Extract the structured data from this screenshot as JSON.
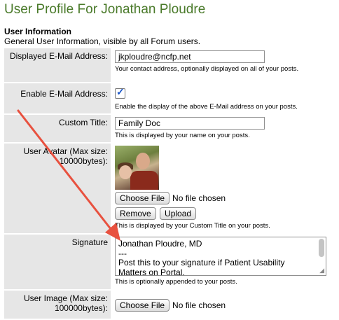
{
  "page": {
    "title": "User Profile For Jonathan Ploudre"
  },
  "section": {
    "heading": "User Information",
    "description": "General User Information, visible by all Forum users."
  },
  "fields": {
    "email": {
      "label": "Displayed E-Mail Address:",
      "value": "jkploudre@ncfp.net",
      "help": "Your contact address, optionally displayed on all of your posts."
    },
    "enable_email": {
      "label": "Enable E-Mail Address:",
      "checked": true,
      "help": "Enable the display of the above E-Mail address on your posts."
    },
    "custom_title": {
      "label": "Custom Title:",
      "value": "Family Doc",
      "help": "This is displayed by your name on your posts."
    },
    "avatar": {
      "label_line1": "User Avatar (Max size:",
      "label_line2": "10000bytes):",
      "choose_label": "Choose File",
      "no_file_text": "No file chosen",
      "remove_label": "Remove",
      "upload_label": "Upload",
      "help": "This is displayed by your Custom Title on your posts."
    },
    "signature": {
      "label": "Signature",
      "lines": [
        "Jonathan Ploudre, MD",
        "---",
        "Post this to your signature if Patient Usability",
        "Matters on Portal."
      ],
      "help": "This is optionally appended to your posts."
    },
    "user_image": {
      "label_line1": "User Image (Max size:",
      "label_line2": "100000bytes):",
      "choose_label": "Choose File",
      "no_file_text": "No file chosen"
    }
  },
  "colors": {
    "title": "#4a7a2a",
    "label_bg": "#e6e6e6",
    "arrow": "#e8513f",
    "checkbox_tick": "#1a56c8"
  }
}
